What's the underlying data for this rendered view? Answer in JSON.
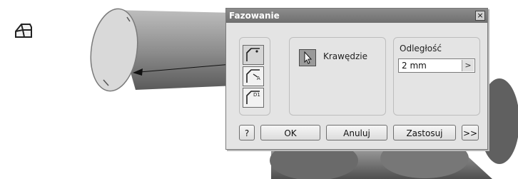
{
  "dialog": {
    "title": "Fazowanie",
    "close_label": "×",
    "mode_buttons": [
      {
        "name": "distance-mode",
        "active": true
      },
      {
        "name": "distance-angle-mode",
        "active": false
      },
      {
        "name": "two-distances-mode",
        "active": false
      }
    ],
    "edges_label": "Krawędzie",
    "distance_label": "Odległość",
    "distance_value": "2 mm",
    "distance_arrow": ">",
    "buttons": {
      "help": "?",
      "ok": "OK",
      "cancel": "Anuluj",
      "apply": "Zastosuj",
      "more": ">>"
    }
  },
  "icons": {
    "chamfer_tool": "chamfer-icon",
    "edge_select": "cursor-arrow-icon"
  },
  "colors": {
    "titlebar": "#7a7a7a",
    "dialog_bg": "#e4e4e4",
    "model_shading": "#9a9a9a"
  }
}
